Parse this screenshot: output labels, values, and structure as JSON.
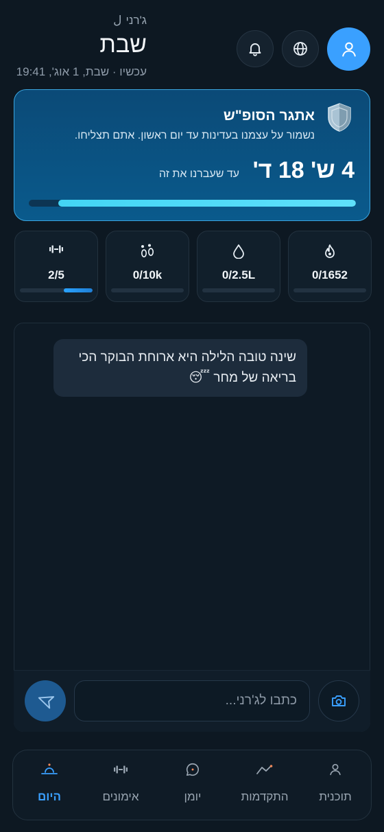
{
  "header": {
    "assistant_name": "ג'רני",
    "day_title": "שבת",
    "timestamp": "עכשיו · שבת, 1 אוג', 19:41"
  },
  "challenge": {
    "title": "אתגר הסופ\"ש",
    "description": "נשמור על עצמנו בעדינות עד יום ראשון. אתם תצליחו.",
    "countdown": "4 ש' 18 ד'",
    "until_label": "עד שעברנו את זה",
    "progress": 0.91
  },
  "stats": [
    {
      "icon": "flame-icon",
      "value": "0/1652",
      "progress": 0
    },
    {
      "icon": "water-drop-icon",
      "value": "0/2.5L",
      "progress": 0
    },
    {
      "icon": "footsteps-icon",
      "value": "0/10k",
      "progress": 0
    },
    {
      "icon": "dumbbell-icon",
      "value": "2/5",
      "progress": 0.4
    }
  ],
  "chat": {
    "message": "שינה טובה הלילה היא ארוחת הבוקר הכי בריאה של מחר 😴",
    "input_placeholder": "כתבו לג'רני..."
  },
  "nav": {
    "items": [
      {
        "label": "תוכנית",
        "icon": "user-icon"
      },
      {
        "label": "התקדמות",
        "icon": "trend-icon"
      },
      {
        "label": "יומן",
        "icon": "chat-icon"
      },
      {
        "label": "אימונים",
        "icon": "dumbbell-icon"
      },
      {
        "label": "היום",
        "icon": "sunrise-icon",
        "active": true
      }
    ]
  },
  "colors": {
    "accent": "#3aa0ff",
    "background": "#0d1822",
    "progress": "#43d5f5"
  }
}
